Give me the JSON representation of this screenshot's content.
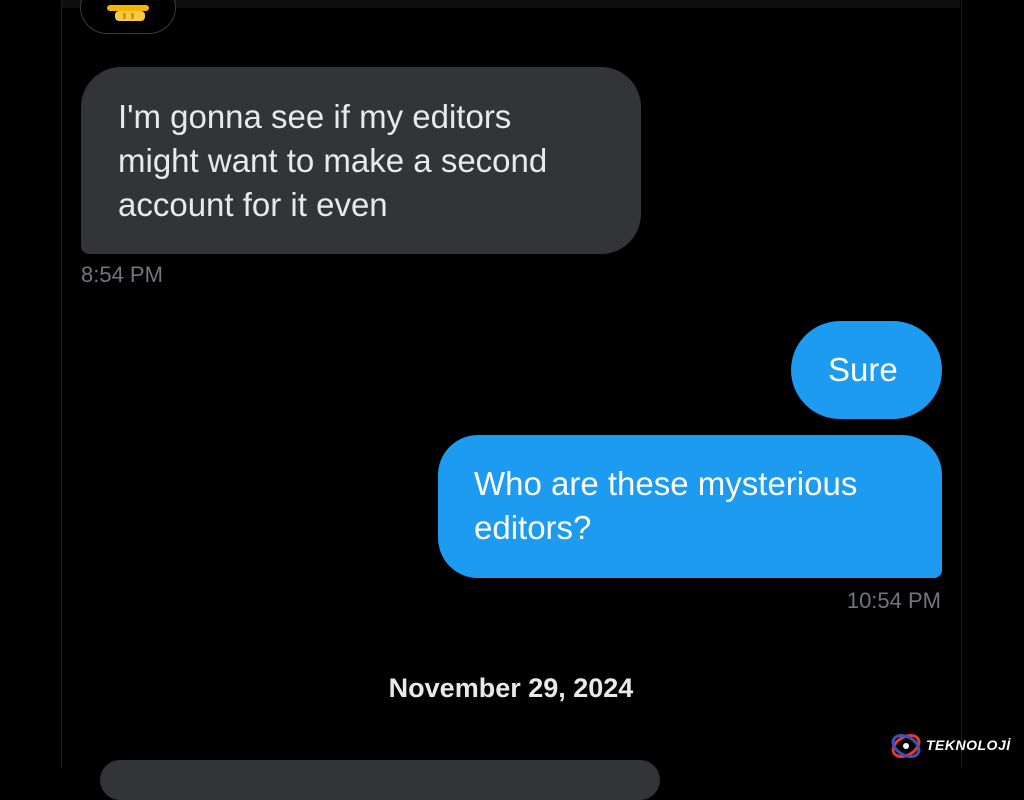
{
  "conversation": {
    "reaction": {
      "icon": "pointing-hand-emoji-icon"
    },
    "messages": [
      {
        "direction": "received",
        "text": "I'm gonna see if my editors\nmight want to make a second\naccount for it even"
      },
      {
        "direction": "sent",
        "text": "Sure"
      },
      {
        "direction": "sent",
        "text": "Who are these mysterious\neditors?"
      }
    ],
    "timestamps": {
      "received": "8:54 PM",
      "sent": "10:54 PM"
    },
    "date_divider": "November 29, 2024"
  },
  "watermark": {
    "text": "TEKNOLOJİ",
    "icon": "teknoloji-logo-icon"
  },
  "colors": {
    "background": "#000000",
    "received_bubble": "#333437",
    "sent_bubble": "#1d9bf0",
    "timestamp_text": "#71767b",
    "primary_text": "#e7e9ea"
  }
}
